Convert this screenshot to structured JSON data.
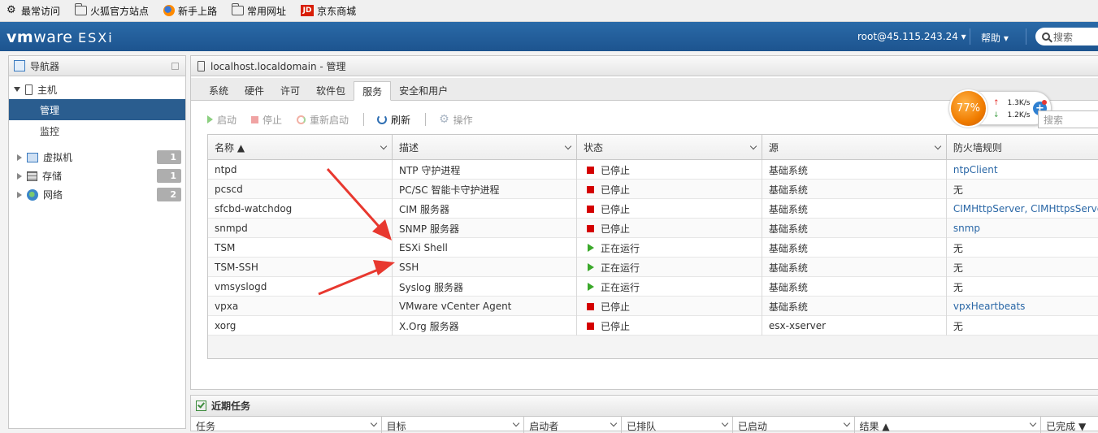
{
  "bookmarks": [
    {
      "label": "最常访问",
      "icon": "gear-icon"
    },
    {
      "label": "火狐官方站点",
      "icon": "folder-icon"
    },
    {
      "label": "新手上路",
      "icon": "firefox-icon"
    },
    {
      "label": "常用网址",
      "icon": "folder-icon"
    },
    {
      "label": "京东商城",
      "icon": "jd-icon",
      "badge": "JD"
    }
  ],
  "appbar": {
    "brand_vm": "vm",
    "brand_ware": "ware",
    "brand_esxi": "ESXi",
    "user": "root@45.115.243.24",
    "help": "帮助",
    "search_placeholder": "搜索",
    "color": "#235f9c"
  },
  "navigator": {
    "title": "导航器",
    "host": "主机",
    "host_children": [
      "管理",
      "监控"
    ],
    "items": [
      {
        "label": "虚拟机",
        "count": "1",
        "icon": "vm-icon"
      },
      {
        "label": "存储",
        "count": "1",
        "icon": "storage-icon"
      },
      {
        "label": "网络",
        "count": "2",
        "icon": "network-icon"
      }
    ]
  },
  "main": {
    "title_host": "localhost.localdomain",
    "title_suffix": " - 管理",
    "tabs": [
      "系统",
      "硬件",
      "许可",
      "软件包",
      "服务",
      "安全和用户"
    ],
    "active_tab": "服务",
    "toolbar": {
      "start": "启动",
      "stop": "停止",
      "restart": "重新启动",
      "refresh": "刷新",
      "actions": "操作"
    },
    "filter_placeholder": "搜索",
    "columns": [
      "名称 ▲",
      "描述",
      "状态",
      "源",
      "防火墙规则"
    ],
    "rows": [
      {
        "name": "ntpd",
        "desc": "NTP 守护进程",
        "status": "已停止",
        "running": false,
        "source": "基础系统",
        "firewall": "ntpClient",
        "fw_link": true
      },
      {
        "name": "pcscd",
        "desc": "PC/SC 智能卡守护进程",
        "status": "已停止",
        "running": false,
        "source": "基础系统",
        "firewall": "无",
        "fw_link": false
      },
      {
        "name": "sfcbd-watchdog",
        "desc": "CIM 服务器",
        "status": "已停止",
        "running": false,
        "source": "基础系统",
        "firewall": "CIMHttpServer, CIMHttpsServer",
        "fw_link": true
      },
      {
        "name": "snmpd",
        "desc": "SNMP 服务器",
        "status": "已停止",
        "running": false,
        "source": "基础系统",
        "firewall": "snmp",
        "fw_link": true
      },
      {
        "name": "TSM",
        "desc": "ESXi Shell",
        "status": "正在运行",
        "running": true,
        "source": "基础系统",
        "firewall": "无",
        "fw_link": false
      },
      {
        "name": "TSM-SSH",
        "desc": "SSH",
        "status": "正在运行",
        "running": true,
        "source": "基础系统",
        "firewall": "无",
        "fw_link": false
      },
      {
        "name": "vmsyslogd",
        "desc": "Syslog 服务器",
        "status": "正在运行",
        "running": true,
        "source": "基础系统",
        "firewall": "无",
        "fw_link": false
      },
      {
        "name": "vpxa",
        "desc": "VMware vCenter Agent",
        "status": "已停止",
        "running": false,
        "source": "基础系统",
        "firewall": "vpxHeartbeats",
        "fw_link": true
      },
      {
        "name": "xorg",
        "desc": "X.Org 服务器",
        "status": "已停止",
        "running": false,
        "source": "esx-xserver",
        "firewall": "无",
        "fw_link": false
      }
    ]
  },
  "net_widget": {
    "percent": "77%",
    "up": "1.3K/s",
    "down": "1.2K/s"
  },
  "tasks": {
    "title": "近期任务",
    "columns": [
      "任务",
      "目标",
      "启动者",
      "已排队",
      "已启动",
      "结果 ▲",
      "已完成 ▼"
    ]
  },
  "colors": {
    "accent": "#2a5d8f",
    "stopped": "#d40000",
    "running": "#3aa82a",
    "annotation": "#e8382f"
  }
}
